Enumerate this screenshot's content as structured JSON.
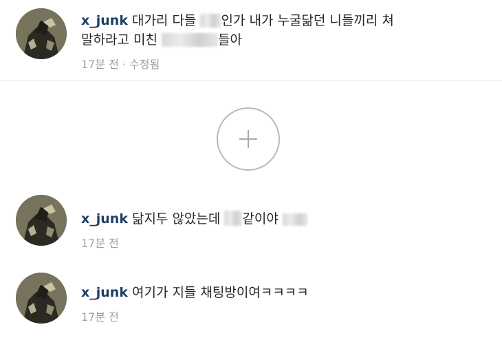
{
  "comments": [
    {
      "username": "x_junk",
      "text_parts": [
        "대가리 다들 ",
        "인가 내가 누굴닮던 니들끼리 쳐",
        "말하라고 미친 ",
        "들아"
      ],
      "time": "17분 전 · 수정됨"
    },
    {
      "username": "x_junk",
      "text_parts": [
        "닮지두 않았는데 ",
        "같이야 "
      ],
      "time": "17분 전"
    },
    {
      "username": "x_junk",
      "text_parts": [
        "여기가 지들 채팅방이여ㅋㅋㅋㅋ"
      ],
      "time": "17분 전"
    }
  ],
  "load_more": {
    "icon": "plus-icon"
  },
  "colors": {
    "username": "#1d3f63",
    "text": "#262626",
    "meta": "#a0a0a0",
    "divider": "#e3e3e3"
  }
}
